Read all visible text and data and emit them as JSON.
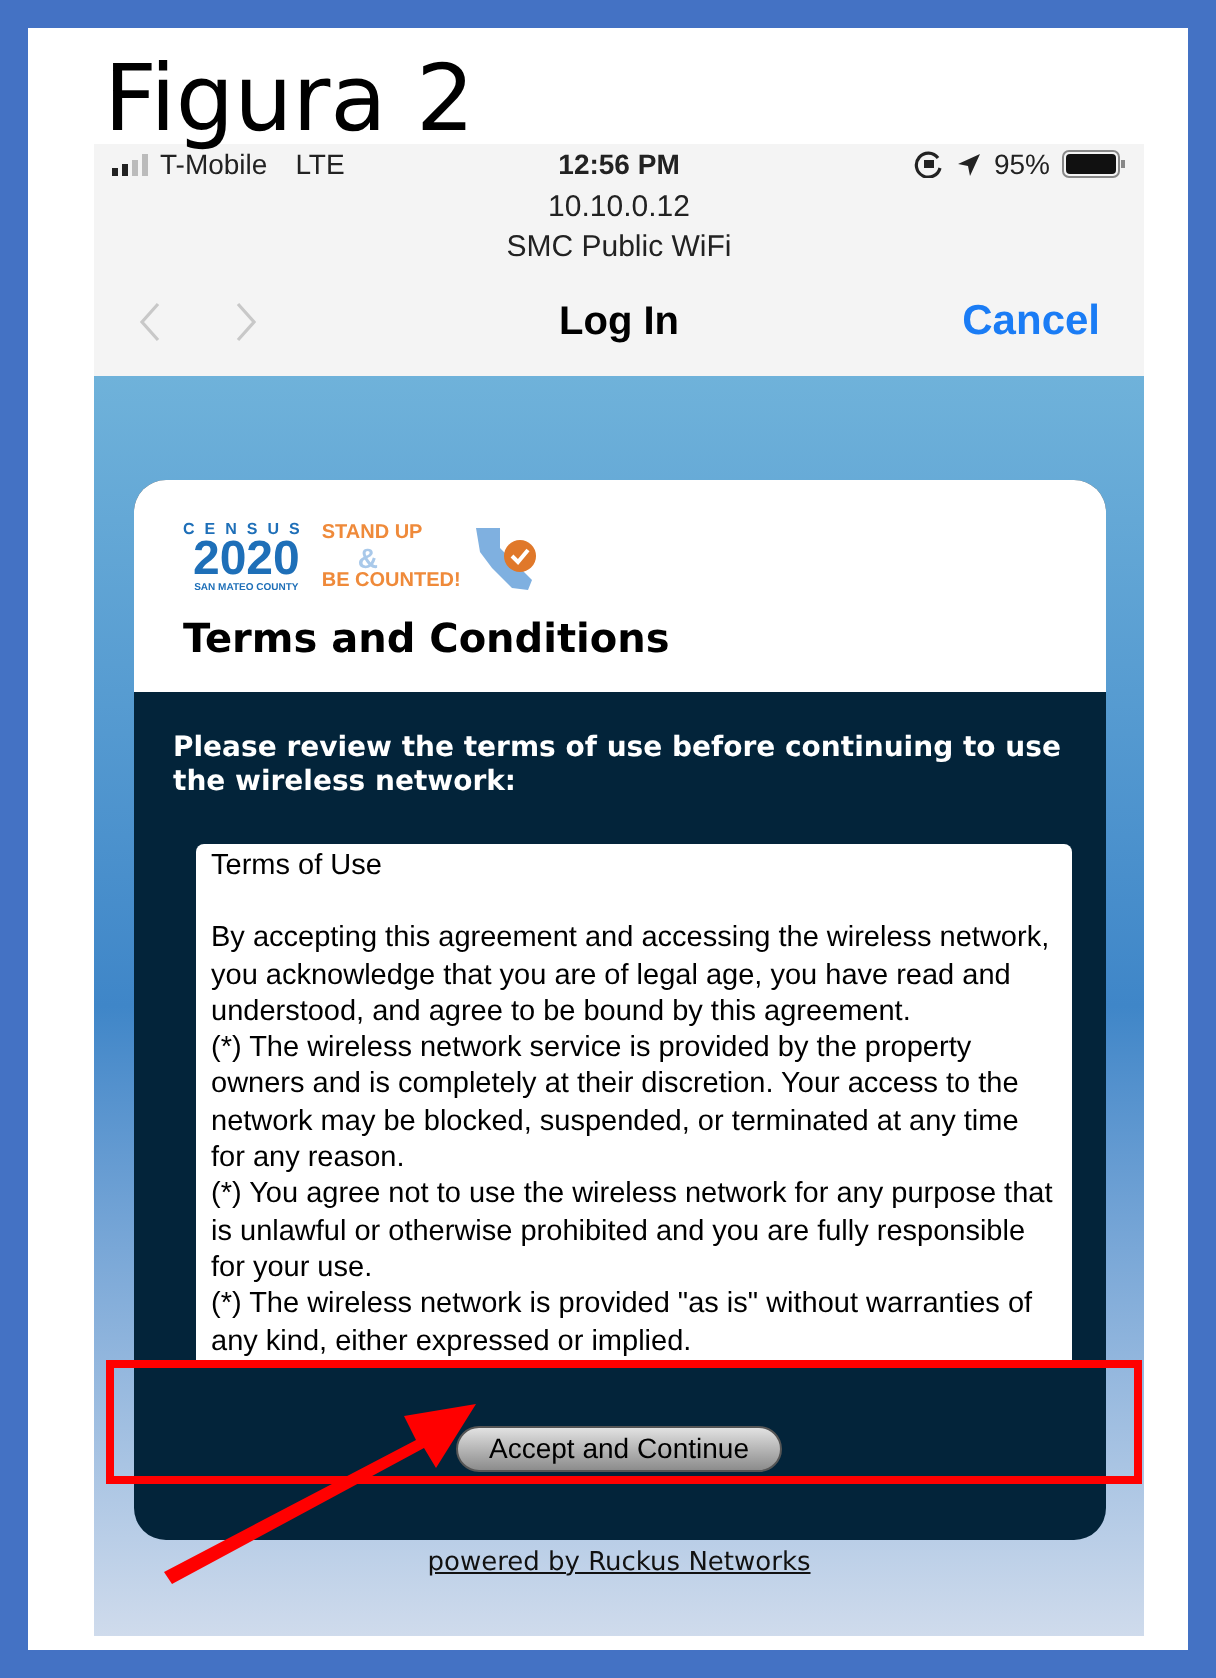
{
  "slide": {
    "title": "Figura 2"
  },
  "status_bar": {
    "carrier": "T-Mobile",
    "network": "LTE",
    "time": "12:56 PM",
    "battery": "95%"
  },
  "address": {
    "host": "10.10.0.12",
    "network_name": "SMC Public WiFi"
  },
  "nav_bar": {
    "back": {
      "disabled": true
    },
    "forward": {
      "disabled": true
    },
    "title": "Log In",
    "cancel": "Cancel"
  },
  "logo": {
    "census": "CENSUS",
    "year": "2020",
    "county": "SAN MATEO COUNTY",
    "slogan_top": "STAND UP",
    "ampersand": "&",
    "slogan_bottom": "BE COUNTED!"
  },
  "card": {
    "heading": "Terms and Conditions",
    "intro": "Please review the terms of use before continuing to use the wireless network:",
    "terms": {
      "title": "Terms of Use",
      "paragraphs": [
        "By accepting this agreement and accessing the wireless network, you acknowledge that you are of legal age, you have read and understood, and agree to be bound by this agreement.",
        "(*) The wireless network service is provided by the property owners and is completely at their discretion. Your access to the network may be blocked, suspended, or terminated at any time for any reason.",
        "(*) You agree not to use the wireless network for any purpose that is unlawful or otherwise prohibited and you are fully responsible for your use.",
        "(*) The wireless network is provided \"as is\" without warranties of any kind, either expressed or implied."
      ]
    },
    "button": "Accept and Continue"
  },
  "footer_link": "powered by Ruckus Networks"
}
